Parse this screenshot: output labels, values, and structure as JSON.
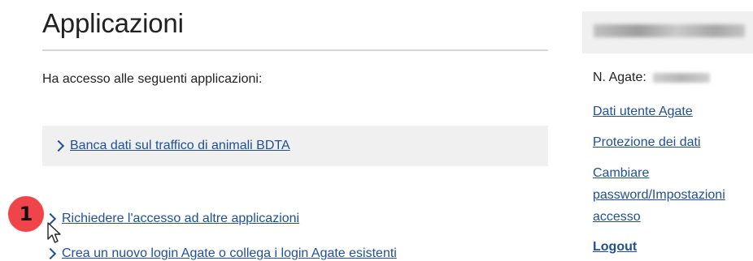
{
  "main": {
    "title": "Applicazioni",
    "intro": "Ha accesso alle seguenti applicazioni:",
    "applications": [
      {
        "label": "Banca dati sul traffico di animali BDTA"
      }
    ],
    "actions": [
      {
        "label": "Richiedere l'accesso ad altre applicazioni"
      },
      {
        "label": "Crea un nuovo login Agate o collega i login Agate esistenti"
      }
    ],
    "step_badge": "1"
  },
  "sidebar": {
    "agate_label": "N. Agate:",
    "links": [
      {
        "label": "Dati utente Agate"
      },
      {
        "label": "Protezione dei dati"
      },
      {
        "label": "Cambiare password/Impostazioni accesso"
      }
    ],
    "logout": "Logout"
  },
  "colors": {
    "link": "#1f4f9a",
    "badge": "#f0444b",
    "panel_bg": "#f0f0f0"
  }
}
